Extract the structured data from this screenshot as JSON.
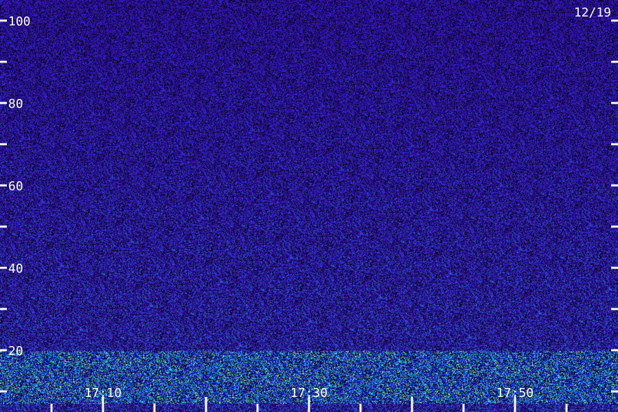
{
  "chart_data": {
    "type": "heatmap",
    "title": "",
    "date": "12/19",
    "y_ticks": [
      {
        "value": 100,
        "label": "100"
      },
      {
        "value": 80,
        "label": "80"
      },
      {
        "value": 60,
        "label": "60"
      },
      {
        "value": 40,
        "label": "40"
      },
      {
        "value": 20,
        "label": "20"
      }
    ],
    "y_minor_ticks": [
      90,
      70,
      50,
      30,
      10
    ],
    "ylim": [
      10,
      100
    ],
    "x_ticks": [
      {
        "value": "17:10",
        "label": "17:10"
      },
      {
        "value": "17:30",
        "label": "17:30"
      },
      {
        "value": "17:50",
        "label": "17:50"
      }
    ],
    "xlim": [
      "17:00",
      "18:00"
    ],
    "x_minor_tick_interval_minutes": 5,
    "colors": {
      "background": "#2a0a8c",
      "low": "#000000",
      "mid": "#3a2cff",
      "high": "#19e6c8",
      "hot": "#c8ff50",
      "text": "#ffffff"
    },
    "features": [
      {
        "name": "strong band",
        "y_range": [
          12,
          20
        ],
        "intensity": "high"
      }
    ]
  }
}
